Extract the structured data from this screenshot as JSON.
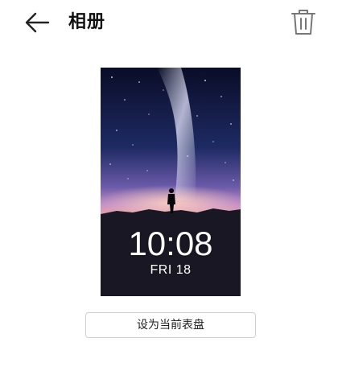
{
  "header": {
    "title": "相册",
    "back_icon": "arrow-left-icon",
    "delete_icon": "trash-icon"
  },
  "preview": {
    "time": "10:08",
    "date": "FRI 18"
  },
  "actions": {
    "set_current_label": "设为当前表盘"
  },
  "colors": {
    "text": "#111111",
    "icon_gray": "#777777",
    "button_border": "#cfcfcf"
  }
}
